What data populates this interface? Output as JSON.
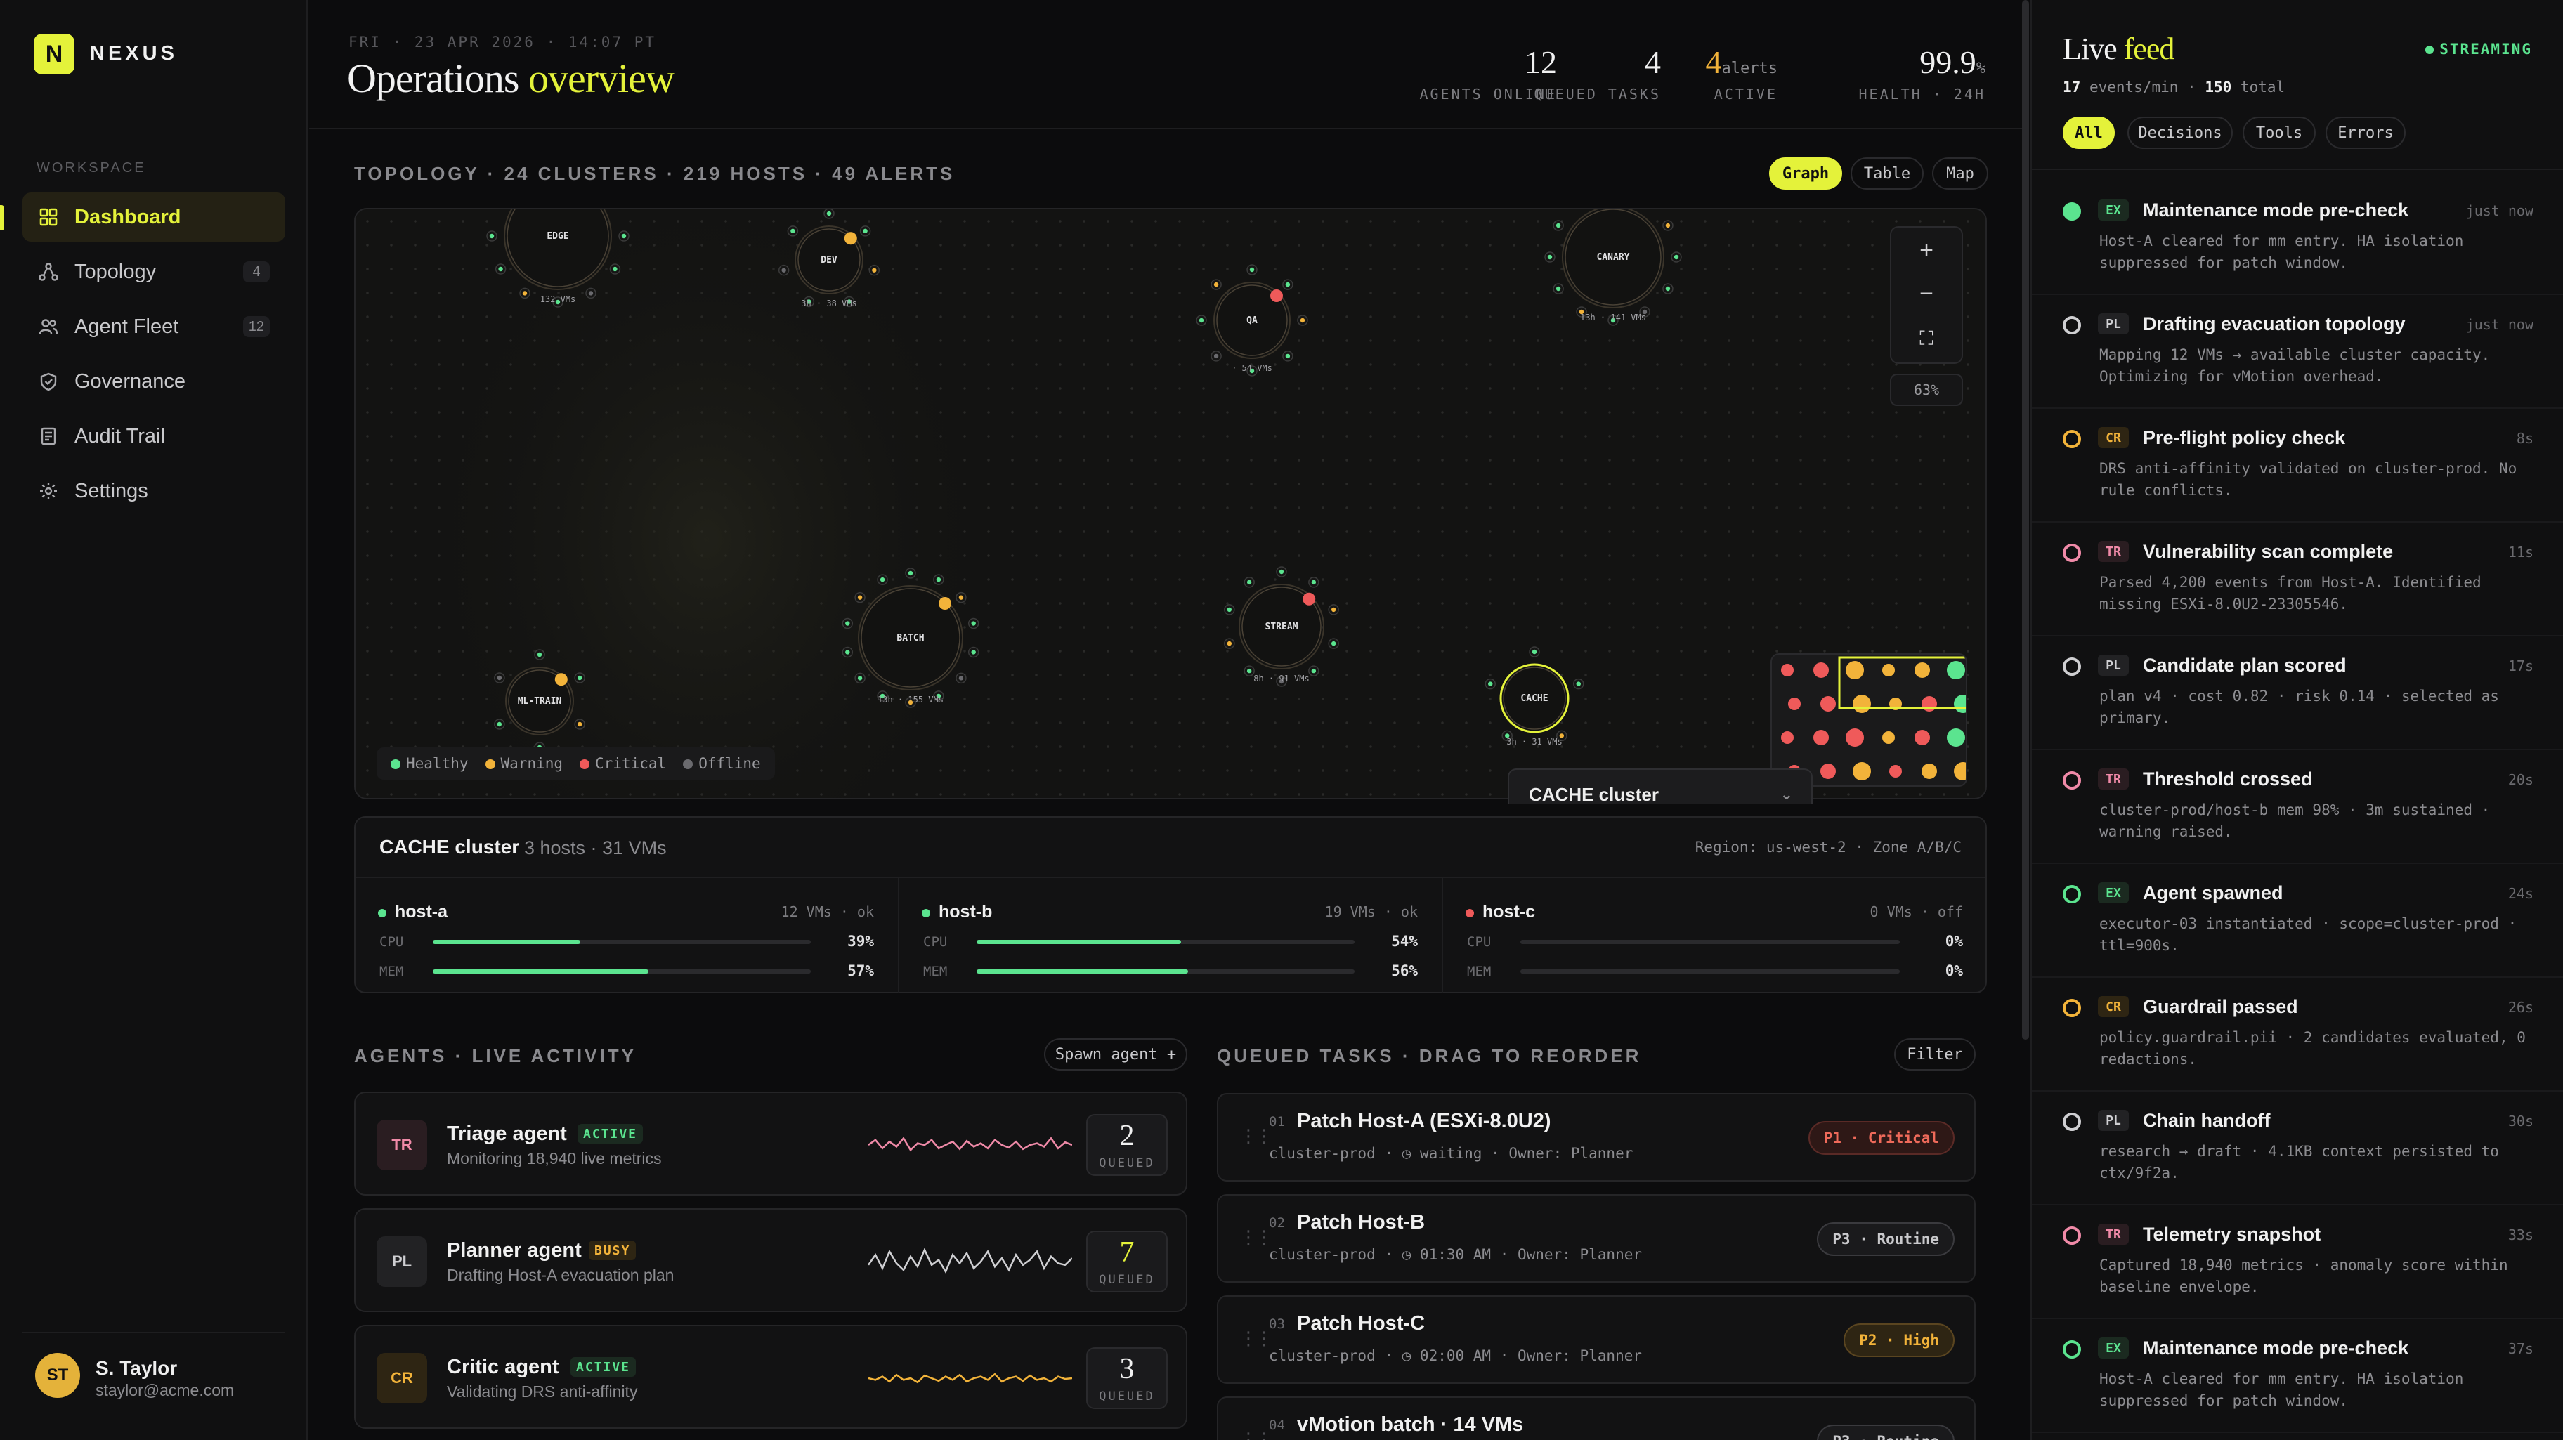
{
  "brand": {
    "logo_letter": "N",
    "name": "NEXUS",
    "accent": "#e4f23a"
  },
  "sidebar": {
    "section": "WORKSPACE",
    "items": [
      {
        "label": "Dashboard",
        "badge": ""
      },
      {
        "label": "Topology",
        "badge": "4"
      },
      {
        "label": "Agent Fleet",
        "badge": "12"
      },
      {
        "label": "Governance",
        "badge": ""
      },
      {
        "label": "Audit Trail",
        "badge": ""
      },
      {
        "label": "Settings",
        "badge": ""
      }
    ],
    "user": {
      "initials": "ST",
      "name": "S. Taylor",
      "email": "staylor@acme.com"
    }
  },
  "header": {
    "date": "FRI · 23 APR 2026 · 14:07 PT",
    "title_main": "Operations",
    "title_accent": "overview",
    "stats": [
      {
        "value": "12",
        "label": "AGENTS ONLINE"
      },
      {
        "value": "4",
        "label": "QUEUED TASKS"
      },
      {
        "value": "4",
        "unit": "alerts",
        "label": "ACTIVE"
      },
      {
        "value": "99.9",
        "unit": "%",
        "label": "HEALTH · 24H"
      }
    ]
  },
  "topology": {
    "title": "TOPOLOGY · 24 CLUSTERS · 219 HOSTS · 49 ALERTS",
    "views": [
      "Graph",
      "Table",
      "Map"
    ],
    "active_view": "Graph",
    "zoom": "63%",
    "zoom_in": "+",
    "zoom_out": "−",
    "fit": "⛶",
    "clusters": [
      {
        "name": "EDGE",
        "caption": "132 VMs"
      },
      {
        "name": "DEV",
        "caption": "3h · 38 VMs"
      },
      {
        "name": "QA",
        "caption": "· 54 VMs"
      },
      {
        "name": "CANARY",
        "caption": "13h · 141 VMs"
      },
      {
        "name": "BATCH",
        "caption": "13h · 155 VMs"
      },
      {
        "name": "STREAM",
        "caption": "8h · 91 VMs"
      },
      {
        "name": "ML-TRAIN",
        "caption": ""
      },
      {
        "name": "CACHE",
        "caption": "3h · 31 VMs"
      }
    ],
    "legend": [
      "Healthy",
      "Warning",
      "Critical",
      "Offline"
    ],
    "colors": {
      "healthy": "#5be48f",
      "warning": "#f2b33a",
      "critical": "#ef5a5a",
      "offline": "#6a6a6e"
    },
    "tooltip": "CACHE cluster"
  },
  "cluster": {
    "name": "CACHE cluster",
    "summary": "3 hosts · 31 VMs",
    "region": "Region: us-west-2 · Zone A/B/C",
    "hosts": [
      {
        "name": "host-a",
        "meta": "12 VMs · ok",
        "status_color": "#5be48f",
        "cpu": "39%",
        "mem": "57%",
        "cpu_frac": 0.39,
        "mem_frac": 0.57
      },
      {
        "name": "host-b",
        "meta": "19 VMs · ok",
        "status_color": "#5be48f",
        "cpu": "54%",
        "mem": "56%",
        "cpu_frac": 0.54,
        "mem_frac": 0.56
      },
      {
        "name": "host-c",
        "meta": "0 VMs · off",
        "status_color": "#ef5a5a",
        "cpu": "0%",
        "mem": "0%",
        "cpu_frac": 0,
        "mem_frac": 0
      }
    ],
    "cpu_label": "CPU",
    "mem_label": "MEM"
  },
  "agents": {
    "title": "AGENTS · LIVE ACTIVITY",
    "spawn_label": "Spawn agent +",
    "items": [
      {
        "initials": "TR",
        "name": "Triage agent",
        "status": "ACTIVE",
        "desc": "Monitoring 18,940 live metrics",
        "queued": "2",
        "queued_label": "QUEUED",
        "color": "#f08aa8"
      },
      {
        "initials": "PL",
        "name": "Planner agent",
        "status": "BUSY",
        "desc": "Drafting Host-A evacuation plan",
        "queued": "7",
        "queued_label": "QUEUED",
        "color": "#cfcfd2"
      },
      {
        "initials": "CR",
        "name": "Critic agent",
        "status": "ACTIVE",
        "desc": "Validating DRS anti-affinity",
        "queued": "3",
        "queued_label": "QUEUED",
        "color": "#f2b33a"
      }
    ]
  },
  "tasks": {
    "title": "QUEUED TASKS · DRAG TO REORDER",
    "filter_label": "Filter",
    "items": [
      {
        "num": "01",
        "title": "Patch Host-A (ESXi-8.0U2)",
        "meta": "cluster-prod  ·  ◷ waiting  ·  Owner: Planner",
        "priority": "P1 · Critical"
      },
      {
        "num": "02",
        "title": "Patch Host-B",
        "meta": "cluster-prod  ·  ◷ 01:30 AM  ·  Owner: Planner",
        "priority": "P3 · Routine"
      },
      {
        "num": "03",
        "title": "Patch Host-C",
        "meta": "cluster-prod  ·  ◷ 02:00 AM  ·  Owner: Planner",
        "priority": "P2 · High"
      },
      {
        "num": "04",
        "title": "vMotion batch · 14 VMs",
        "meta": "",
        "priority": "P3 · Routine"
      }
    ]
  },
  "feed": {
    "title_main": "Live",
    "title_accent": "feed",
    "streaming": "STREAMING",
    "rate": "17",
    "rate_label": "events/min ·",
    "total": "150",
    "total_label": "total",
    "filters": [
      "All",
      "Decisions",
      "Tools",
      "Errors"
    ],
    "items": [
      {
        "tag": "EX",
        "title": "Maintenance mode pre-check",
        "time": "just now",
        "body": "Host-A cleared for mm entry. HA isolation suppressed for patch window."
      },
      {
        "tag": "PL",
        "title": "Drafting evacuation topology",
        "time": "just now",
        "body": "Mapping 12 VMs → available cluster capacity. Optimizing for vMotion overhead."
      },
      {
        "tag": "CR",
        "title": "Pre-flight policy check",
        "time": "8s",
        "body": "DRS anti-affinity validated on cluster-prod. No rule conflicts."
      },
      {
        "tag": "TR",
        "title": "Vulnerability scan complete",
        "time": "11s",
        "body": "Parsed 4,200 events from Host-A. Identified missing ESXi-8.0U2-23305546."
      },
      {
        "tag": "PL",
        "title": "Candidate plan scored",
        "time": "17s",
        "body": "plan v4 · cost 0.82 · risk 0.14 · selected as primary."
      },
      {
        "tag": "TR",
        "title": "Threshold crossed",
        "time": "20s",
        "body": "cluster-prod/host-b mem 98% · 3m sustained · warning raised."
      },
      {
        "tag": "EX",
        "title": "Agent spawned",
        "time": "24s",
        "body": "executor-03 instantiated · scope=cluster-prod · ttl=900s."
      },
      {
        "tag": "CR",
        "title": "Guardrail passed",
        "time": "26s",
        "body": "policy.guardrail.pii · 2 candidates evaluated, 0 redactions."
      },
      {
        "tag": "PL",
        "title": "Chain handoff",
        "time": "30s",
        "body": "research → draft · 4.1KB context persisted to ctx/9f2a."
      },
      {
        "tag": "TR",
        "title": "Telemetry snapshot",
        "time": "33s",
        "body": "Captured 18,940 metrics · anomaly score within baseline envelope."
      },
      {
        "tag": "EX",
        "title": "Maintenance mode pre-check",
        "time": "37s",
        "body": "Host-A cleared for mm entry. HA isolation suppressed for patch window."
      }
    ]
  }
}
